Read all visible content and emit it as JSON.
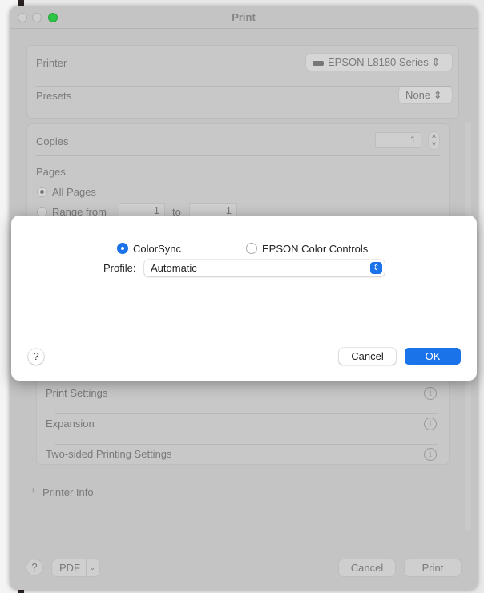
{
  "window": {
    "title": "Print"
  },
  "printer": {
    "label": "Printer",
    "value": "EPSON L8180 Series"
  },
  "presets": {
    "label": "Presets",
    "value": "None"
  },
  "copies": {
    "label": "Copies",
    "value": "1"
  },
  "pages": {
    "label": "Pages",
    "all_label": "All Pages",
    "range_label": "Range from",
    "from": "1",
    "to_label": "to",
    "to": "1"
  },
  "sections": [
    {
      "label": "Print Settings"
    },
    {
      "label": "Expansion"
    },
    {
      "label": "Two-sided Printing Settings"
    }
  ],
  "printer_info": "Printer Info",
  "footer": {
    "help": "?",
    "pdf": "PDF",
    "cancel": "Cancel",
    "print": "Print"
  },
  "sheet": {
    "colorsync": "ColorSync",
    "epson": "EPSON Color Controls",
    "profile_label": "Profile:",
    "profile_value": "Automatic",
    "help": "?",
    "cancel": "Cancel",
    "ok": "OK",
    "selected": "ColorSync"
  }
}
